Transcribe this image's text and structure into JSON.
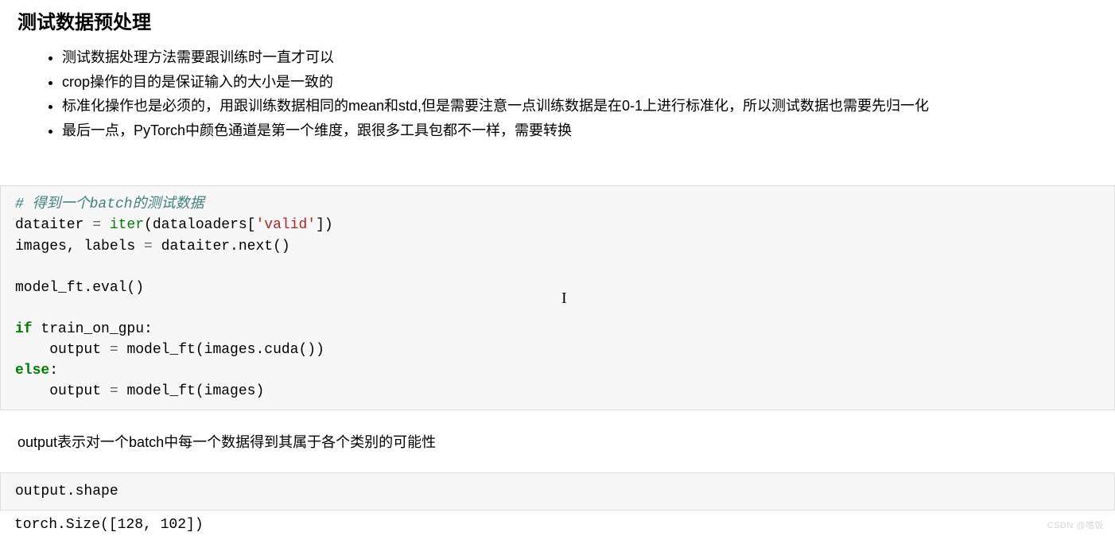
{
  "heading": "测试数据预处理",
  "bullets": [
    "测试数据处理方法需要跟训练时一直才可以",
    "crop操作的目的是保证输入的大小是一致的",
    "标准化操作也是必须的，用跟训练数据相同的mean和std,但是需要注意一点训练数据是在0-1上进行标准化，所以测试数据也需要先归一化",
    "最后一点，PyTorch中颜色通道是第一个维度，跟很多工具包都不一样，需要转换"
  ],
  "code1": {
    "comment": "# 得到一个batch的测试数据",
    "l2a": "dataiter ",
    "l2op": "= ",
    "l2b": "iter",
    "l2c": "(dataloaders[",
    "l2s": "'valid'",
    "l2d": "])",
    "l3": "images, labels ",
    "l3op": "= ",
    "l3b": "dataiter.next()",
    "l5a": "model_ft.eval()",
    "l7k": "if",
    "l7a": " train_on_gpu:",
    "l8a": "    output ",
    "l8op": "= ",
    "l8b": "model_ft(images.cuda())",
    "l9k": "else",
    "l9a": ":",
    "l10a": "    output ",
    "l10op": "= ",
    "l10b": "model_ft(images)"
  },
  "md2": "output表示对一个batch中每一个数据得到其属于各个类别的可能性",
  "code2": "output.shape",
  "out2": "torch.Size([128, 102])",
  "watermark": "CSDN @嗜饭"
}
